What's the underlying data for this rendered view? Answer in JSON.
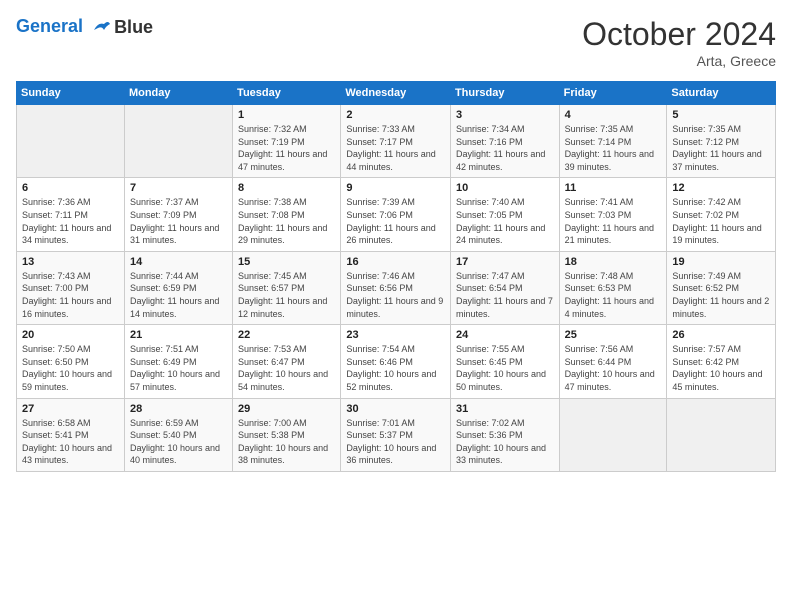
{
  "header": {
    "logo_line1": "General",
    "logo_line2": "Blue",
    "month_title": "October 2024",
    "location": "Arta, Greece"
  },
  "weekdays": [
    "Sunday",
    "Monday",
    "Tuesday",
    "Wednesday",
    "Thursday",
    "Friday",
    "Saturday"
  ],
  "weeks": [
    [
      {
        "day": "",
        "info": ""
      },
      {
        "day": "",
        "info": ""
      },
      {
        "day": "1",
        "info": "Sunrise: 7:32 AM\nSunset: 7:19 PM\nDaylight: 11 hours and 47 minutes."
      },
      {
        "day": "2",
        "info": "Sunrise: 7:33 AM\nSunset: 7:17 PM\nDaylight: 11 hours and 44 minutes."
      },
      {
        "day": "3",
        "info": "Sunrise: 7:34 AM\nSunset: 7:16 PM\nDaylight: 11 hours and 42 minutes."
      },
      {
        "day": "4",
        "info": "Sunrise: 7:35 AM\nSunset: 7:14 PM\nDaylight: 11 hours and 39 minutes."
      },
      {
        "day": "5",
        "info": "Sunrise: 7:35 AM\nSunset: 7:12 PM\nDaylight: 11 hours and 37 minutes."
      }
    ],
    [
      {
        "day": "6",
        "info": "Sunrise: 7:36 AM\nSunset: 7:11 PM\nDaylight: 11 hours and 34 minutes."
      },
      {
        "day": "7",
        "info": "Sunrise: 7:37 AM\nSunset: 7:09 PM\nDaylight: 11 hours and 31 minutes."
      },
      {
        "day": "8",
        "info": "Sunrise: 7:38 AM\nSunset: 7:08 PM\nDaylight: 11 hours and 29 minutes."
      },
      {
        "day": "9",
        "info": "Sunrise: 7:39 AM\nSunset: 7:06 PM\nDaylight: 11 hours and 26 minutes."
      },
      {
        "day": "10",
        "info": "Sunrise: 7:40 AM\nSunset: 7:05 PM\nDaylight: 11 hours and 24 minutes."
      },
      {
        "day": "11",
        "info": "Sunrise: 7:41 AM\nSunset: 7:03 PM\nDaylight: 11 hours and 21 minutes."
      },
      {
        "day": "12",
        "info": "Sunrise: 7:42 AM\nSunset: 7:02 PM\nDaylight: 11 hours and 19 minutes."
      }
    ],
    [
      {
        "day": "13",
        "info": "Sunrise: 7:43 AM\nSunset: 7:00 PM\nDaylight: 11 hours and 16 minutes."
      },
      {
        "day": "14",
        "info": "Sunrise: 7:44 AM\nSunset: 6:59 PM\nDaylight: 11 hours and 14 minutes."
      },
      {
        "day": "15",
        "info": "Sunrise: 7:45 AM\nSunset: 6:57 PM\nDaylight: 11 hours and 12 minutes."
      },
      {
        "day": "16",
        "info": "Sunrise: 7:46 AM\nSunset: 6:56 PM\nDaylight: 11 hours and 9 minutes."
      },
      {
        "day": "17",
        "info": "Sunrise: 7:47 AM\nSunset: 6:54 PM\nDaylight: 11 hours and 7 minutes."
      },
      {
        "day": "18",
        "info": "Sunrise: 7:48 AM\nSunset: 6:53 PM\nDaylight: 11 hours and 4 minutes."
      },
      {
        "day": "19",
        "info": "Sunrise: 7:49 AM\nSunset: 6:52 PM\nDaylight: 11 hours and 2 minutes."
      }
    ],
    [
      {
        "day": "20",
        "info": "Sunrise: 7:50 AM\nSunset: 6:50 PM\nDaylight: 10 hours and 59 minutes."
      },
      {
        "day": "21",
        "info": "Sunrise: 7:51 AM\nSunset: 6:49 PM\nDaylight: 10 hours and 57 minutes."
      },
      {
        "day": "22",
        "info": "Sunrise: 7:53 AM\nSunset: 6:47 PM\nDaylight: 10 hours and 54 minutes."
      },
      {
        "day": "23",
        "info": "Sunrise: 7:54 AM\nSunset: 6:46 PM\nDaylight: 10 hours and 52 minutes."
      },
      {
        "day": "24",
        "info": "Sunrise: 7:55 AM\nSunset: 6:45 PM\nDaylight: 10 hours and 50 minutes."
      },
      {
        "day": "25",
        "info": "Sunrise: 7:56 AM\nSunset: 6:44 PM\nDaylight: 10 hours and 47 minutes."
      },
      {
        "day": "26",
        "info": "Sunrise: 7:57 AM\nSunset: 6:42 PM\nDaylight: 10 hours and 45 minutes."
      }
    ],
    [
      {
        "day": "27",
        "info": "Sunrise: 6:58 AM\nSunset: 5:41 PM\nDaylight: 10 hours and 43 minutes."
      },
      {
        "day": "28",
        "info": "Sunrise: 6:59 AM\nSunset: 5:40 PM\nDaylight: 10 hours and 40 minutes."
      },
      {
        "day": "29",
        "info": "Sunrise: 7:00 AM\nSunset: 5:38 PM\nDaylight: 10 hours and 38 minutes."
      },
      {
        "day": "30",
        "info": "Sunrise: 7:01 AM\nSunset: 5:37 PM\nDaylight: 10 hours and 36 minutes."
      },
      {
        "day": "31",
        "info": "Sunrise: 7:02 AM\nSunset: 5:36 PM\nDaylight: 10 hours and 33 minutes."
      },
      {
        "day": "",
        "info": ""
      },
      {
        "day": "",
        "info": ""
      }
    ]
  ]
}
